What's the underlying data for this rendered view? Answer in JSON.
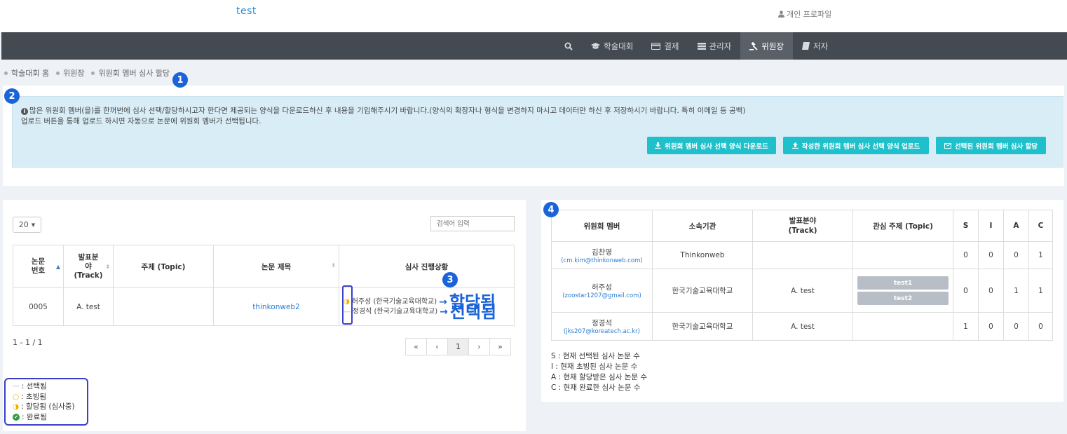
{
  "brand": "test",
  "profile_label": "개인 프로파일",
  "nav": [
    {
      "label": "",
      "icon": "search-icon"
    },
    {
      "label": "학술대회",
      "icon": "graduation-cap-icon"
    },
    {
      "label": "결제",
      "icon": "credit-card-icon"
    },
    {
      "label": "관리자",
      "icon": "server-icon"
    },
    {
      "label": "위원장",
      "icon": "gavel-icon"
    },
    {
      "label": "저자",
      "icon": "book-icon"
    }
  ],
  "breadcrumb": [
    "학술대회 홈",
    "위원장",
    "위원회 멤버 심사 할당"
  ],
  "markers": [
    "1",
    "2",
    "3",
    "4"
  ],
  "alert": {
    "line1": "많은 위원회 멤버(을)를 한꺼번에 심사 선택/할당하시고자 한다면 제공되는 양식을 다운로드하신 후 내용을 기입해주시기 바랍니다.(양식의 확장자나 형식을 변경하지 마시고 데이터만 하신 후 저장하시기 바랍니다. 특히 이메일 등 공백)",
    "line2": "업로드 버튼을 통해 업로드 하시면 자동으로 논문에 위원회 멤버가 선택됩니다.",
    "buttons": [
      "위원회 멤버 심사 선택 양식 다운로드",
      "작성한 위원회 멤버 심사 선택 양식 업로드",
      "선택된 위원회 멤버 심사 할당"
    ]
  },
  "papers": {
    "page_size": "20",
    "search_placeholder": "검색어 입력",
    "headers": [
      "논문\n번호",
      "발표분\n야\n(Track)",
      "주제 (Topic)",
      "논문 제목",
      "심사 진행상황"
    ],
    "rows": [
      {
        "number": "0005",
        "track": "A. test",
        "topic": "",
        "title": "thinkonweb2",
        "progress": [
          {
            "name": "허주성 (한국기술교육대학교)",
            "status": "assigned",
            "annotation": "할당됨"
          },
          {
            "name": "정경석 (한국기술교육대학교)",
            "status": "selected",
            "annotation": "선택됨"
          }
        ]
      }
    ],
    "count": "1 - 1 / 1",
    "pager": [
      "«",
      "‹",
      "1",
      "›",
      "»"
    ]
  },
  "legend": [
    {
      "symbol": "---",
      "label": ": 선택됨"
    },
    {
      "symbol": "○",
      "label": ": 초빙됨"
    },
    {
      "symbol": "◑",
      "label": ": 할당됨 (심사중)"
    },
    {
      "symbol": "✔",
      "label": ": 완료됨"
    }
  ],
  "members": {
    "headers": [
      "위원회 멤버",
      "소속기관",
      "발표분야\n(Track)",
      "관심 주제 (Topic)",
      "S",
      "I",
      "A",
      "C"
    ],
    "rows": [
      {
        "name": "김찬영",
        "email": "(cm.kim@thinkonweb.com)",
        "org": "Thinkonweb",
        "track": "",
        "topics": [],
        "s": "0",
        "i": "0",
        "a": "0",
        "c": "1"
      },
      {
        "name": "허주성",
        "email": "(zoostar1207@gmail.com)",
        "org": "한국기술교육대학교",
        "track": "A. test",
        "topics": [
          "test1",
          "test2"
        ],
        "s": "0",
        "i": "0",
        "a": "1",
        "c": "1"
      },
      {
        "name": "정경석",
        "email": "(jks207@koreatech.ac.kr)",
        "org": "한국기술교육대학교",
        "track": "A. test",
        "topics": [],
        "s": "1",
        "i": "0",
        "a": "0",
        "c": "0"
      }
    ]
  },
  "notes": [
    "S : 현재 선택된 심사 논문 수",
    "I : 현재 초빙된 심사 논문 수",
    "A : 현재 할당받은 심사 논문 수",
    "C : 현재 완료한 심사 논문 수"
  ],
  "colors": {
    "navbar": "#444a52",
    "accent": "#1ec0cc",
    "marker": "#1a63d8",
    "alert_bg": "#d9edf7"
  }
}
